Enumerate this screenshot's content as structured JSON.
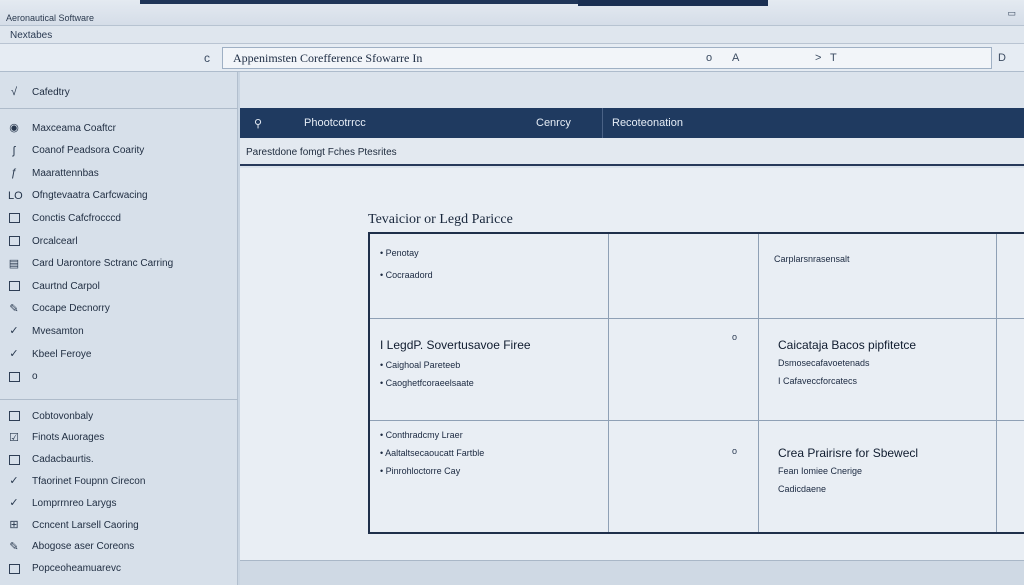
{
  "window": {
    "title": "Aeronautical Software",
    "menu": "Nextabes"
  },
  "address": {
    "url": "Appenimsten Corefference Sfowarre In",
    "left_glyph": "c",
    "mid_icons": [
      "o",
      "A"
    ],
    "right_icons": [
      ">",
      "T"
    ],
    "end_icon": "D"
  },
  "sidebar": {
    "header": "Cafedtry",
    "items": [
      {
        "icon": "circle-icon",
        "glyph": "◉",
        "label": "Maxceama Coaftcr"
      },
      {
        "icon": "script-icon",
        "glyph": "ʃ",
        "label": "Coanof Peadsora Coarity"
      },
      {
        "icon": "script-icon",
        "glyph": "ƒ",
        "label": "Maarattennbas"
      },
      {
        "icon": "list-icon",
        "glyph": "LO",
        "label": "Ofngtevaatra Carfcwacing"
      },
      {
        "icon": "box-icon",
        "glyph": "",
        "label": "Conctis Cafcfrocccd"
      },
      {
        "icon": "box-icon",
        "glyph": "",
        "label": "Orcalcearl"
      },
      {
        "icon": "list-icon",
        "glyph": "▤",
        "label": "Card Uarontore Sctranc Carring"
      },
      {
        "icon": "box-icon",
        "glyph": "",
        "label": "Caurtnd Carpol"
      },
      {
        "icon": "pen-icon",
        "glyph": "✎",
        "label": "Cocape Decnorry"
      },
      {
        "icon": "check-icon",
        "glyph": "✓",
        "label": "Mvesamton"
      },
      {
        "icon": "check-icon",
        "glyph": "✓",
        "label": "Kbeel Feroye"
      },
      {
        "icon": "box-icon",
        "glyph": "",
        "label": "o"
      }
    ],
    "items2": [
      {
        "icon": "box-icon",
        "glyph": "",
        "label": "Cobtovonbaly"
      },
      {
        "icon": "edit-icon",
        "glyph": "☑",
        "label": "Finots Auorages"
      },
      {
        "icon": "box-icon",
        "glyph": "",
        "label": "Cadacbaurtis."
      },
      {
        "icon": "check-icon",
        "glyph": "✓",
        "label": "Tfaorinet Foupnn Cirecon"
      },
      {
        "icon": "check-icon",
        "glyph": "✓",
        "label": "Lomprrnreo Larygs"
      },
      {
        "icon": "grid-icon",
        "glyph": "⊞",
        "label": "Ccncent Larsell Caoring"
      },
      {
        "icon": "pen-icon",
        "glyph": "✎",
        "label": "Abogose aser Coreons"
      },
      {
        "icon": "box-icon",
        "glyph": "",
        "label": "Popceoheamuarevc"
      }
    ]
  },
  "main": {
    "header": {
      "icon": "search-icon",
      "col1": "Phootcotrrcc",
      "col2": "Cenrcy",
      "col3": "Recoteonation"
    },
    "breadcrumb": "Parestdone fomgt Fches Ptesrites",
    "heading": "Tevaicior or Legd Paricce",
    "grid": {
      "r1c1": [
        "Penotay",
        "Cocraadord"
      ],
      "r1c3": "Carplarsnrasensalt",
      "r2c1_title": "I LegdP. Sovertusavoe Firee",
      "r2c1_items": [
        "Caighoal Pareteeb",
        "Caoghetfcoraeelsaate"
      ],
      "r2c2_ind": "o",
      "r2c3_title": "Caicataja Bacos pipfitetce",
      "r2c3_items": [
        "Dsmosecafavoetenads",
        "I Cafaveccforcatecs"
      ],
      "r3c1_items": [
        "Conthradcmy Lraer",
        "Aaltaltsecaoucatt Fartble",
        "Pinrohloctorre Cay"
      ],
      "r3c2_ind": "o",
      "r3c3_title": "Crea Prairisre for Sbewecl",
      "r3c3_items": [
        "Fean Iomiee Cnerige",
        "Cadicdaene"
      ]
    }
  }
}
